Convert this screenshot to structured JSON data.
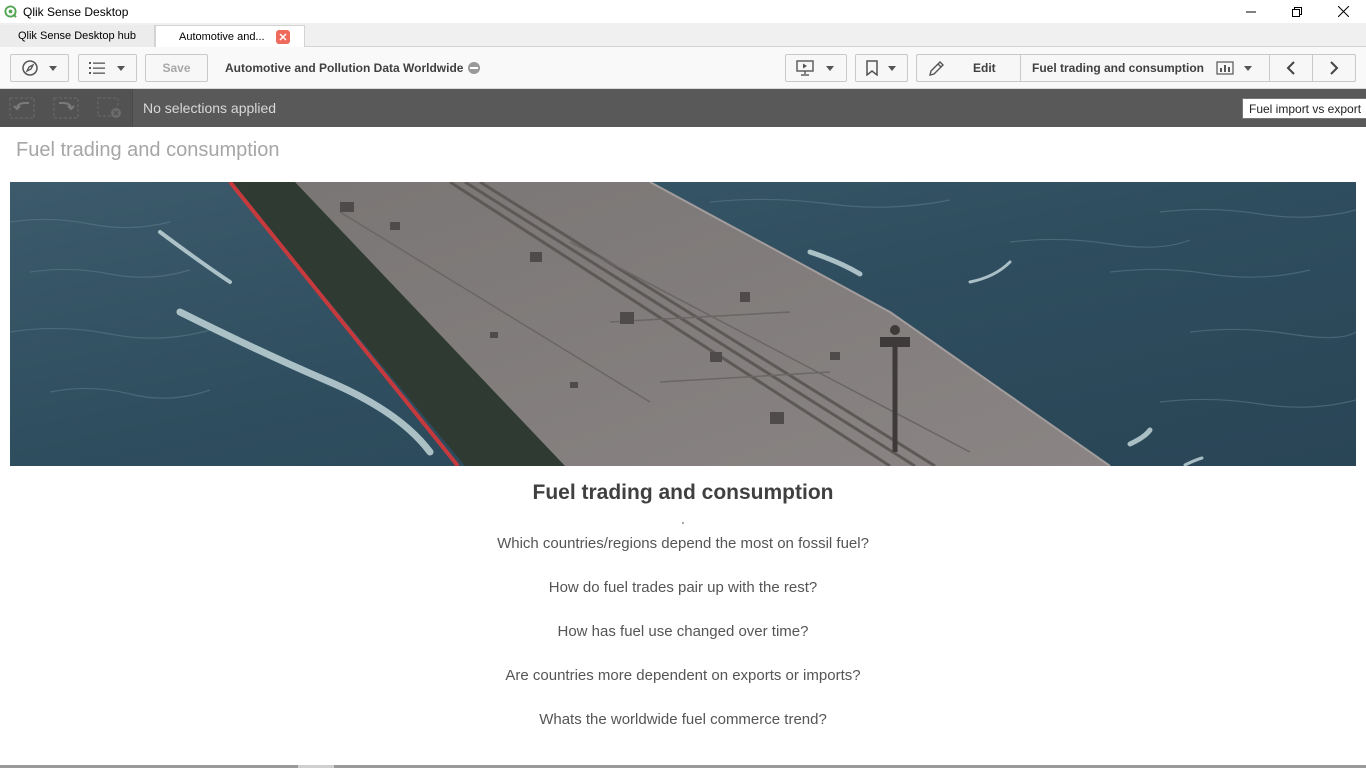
{
  "window": {
    "title": "Qlik Sense Desktop"
  },
  "tabs": [
    {
      "label": "Qlik Sense Desktop hub",
      "active": false
    },
    {
      "label": "Automotive and...",
      "active": true
    }
  ],
  "toolbar": {
    "save_label": "Save",
    "app_name": "Automotive and Pollution Data Worldwide",
    "edit_label": "Edit",
    "current_sheet": "Fuel trading and consumption"
  },
  "selections": {
    "status": "No selections applied"
  },
  "tooltip": {
    "text": "Fuel import vs export"
  },
  "sheet": {
    "title": "Fuel trading and consumption",
    "heading": "Fuel trading and consumption",
    "questions": [
      "Which countries/regions depend the most on fossil fuel?",
      "How do fuel trades pair up with the rest?",
      "How has fuel use changed over time?",
      "Are countries more dependent on exports or imports?",
      "Whats the worldwide fuel commerce trend?"
    ]
  },
  "colors": {
    "qlik_green": "#52a552",
    "selection_bar": "#595959",
    "tab_close": "#f06a5c"
  }
}
